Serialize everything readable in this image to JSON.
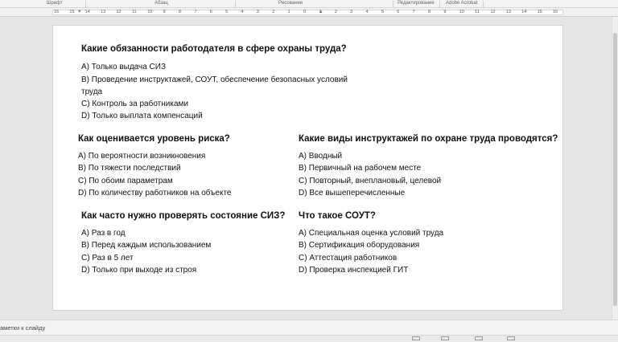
{
  "ribbon": {
    "groups": [
      "Шрифт",
      "Абзац",
      "Рисование",
      "Редактирование",
      "Adobe Acrobat"
    ]
  },
  "ruler": {
    "ticks": [
      "16",
      "15",
      "14",
      "13",
      "12",
      "11",
      "10",
      "9",
      "8",
      "7",
      "6",
      "5",
      "4",
      "3",
      "2",
      "1",
      "0",
      "1",
      "2",
      "3",
      "4",
      "5",
      "6",
      "7",
      "8",
      "9",
      "10",
      "11",
      "12",
      "13",
      "14",
      "15",
      "16"
    ]
  },
  "slide": {
    "q1": {
      "title": "Какие обязанности работодателя в сфере охраны труда?",
      "options": [
        "A) Только выдача СИЗ",
        "B) Проведение инструктажей, СОУТ, обеспечение безопасных условий",
        "труда",
        "C) Контроль за работниками",
        "D) Только выплата компенсаций"
      ]
    },
    "q2": {
      "title": "Как оценивается уровень риска?",
      "options": [
        "A) По вероятности возникновения",
        "B) По тяжести последствий",
        "C) По обоим параметрам",
        "D) По количеству работников на объекте"
      ]
    },
    "q3": {
      "title": "Какие виды инструктажей по охране труда проводятся?",
      "options": [
        "A) Вводный",
        "B) Первичный на рабочем месте",
        "C) Повторный, внеплановый, целевой",
        "D) Все вышеперечисленные"
      ]
    },
    "q4": {
      "title": "Как часто нужно проверять состояние СИЗ?",
      "options": [
        "A) Раз в год",
        "B) Перед каждым использованием",
        "C) Раз в 5 лет",
        "D) Только при выходе из строя"
      ]
    },
    "q5": {
      "title": "Что такое СОУТ?",
      "options": [
        "A) Специальная оценка условий труда",
        "B) Сертификация оборудования",
        "C) Аттестация работников",
        "D) Проверка инспекцией ГИТ"
      ]
    }
  },
  "notes": {
    "placeholder": "аметки к слайду"
  }
}
